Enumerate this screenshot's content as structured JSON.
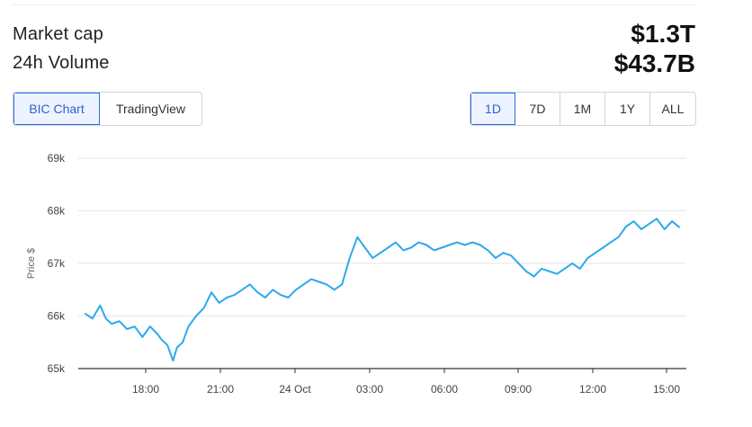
{
  "stats": [
    {
      "label": "Market cap",
      "value": "$1.3T"
    },
    {
      "label": "24h Volume",
      "value": "$43.7B"
    }
  ],
  "chart_source_tabs": {
    "options": [
      "BIC Chart",
      "TradingView"
    ],
    "active": "BIC Chart"
  },
  "range_tabs": {
    "options": [
      "1D",
      "7D",
      "1M",
      "1Y",
      "ALL"
    ],
    "active": "1D"
  },
  "colors": {
    "line": "#2ea8ec",
    "accent": "#2f6be0",
    "grid": "#e6e6e6"
  },
  "chart_data": {
    "type": "line",
    "ylabel": "Price $",
    "ylim": [
      65000,
      69000
    ],
    "y_ticks": [
      {
        "value": 65000,
        "label": "65k"
      },
      {
        "value": 66000,
        "label": "66k"
      },
      {
        "value": 67000,
        "label": "67k"
      },
      {
        "value": 68000,
        "label": "68k"
      },
      {
        "value": 69000,
        "label": "69k"
      }
    ],
    "x_unit": "hours since 00:00, 23 Oct",
    "xlim": [
      15.9,
      31.6
    ],
    "x_ticks": [
      {
        "value": 18,
        "label": "18:00"
      },
      {
        "value": 21,
        "label": "21:00"
      },
      {
        "value": 24,
        "label": "24 Oct"
      },
      {
        "value": 27,
        "label": "03:00"
      },
      {
        "value": 30,
        "label": "06:00"
      },
      {
        "value": 33,
        "label": "09:00"
      },
      {
        "value": 36,
        "label": "12:00"
      },
      {
        "value": 39,
        "label": "15:00"
      }
    ],
    "series": [
      {
        "x": [
          16.0,
          16.2,
          16.4,
          16.55,
          16.7,
          16.9,
          17.1,
          17.3,
          17.5,
          17.7,
          17.9,
          18.0,
          18.15,
          18.3,
          18.4,
          18.55,
          18.7,
          18.9,
          19.1,
          19.3,
          19.5,
          19.7,
          19.9,
          20.1,
          20.3,
          20.5,
          20.7,
          20.9,
          21.1,
          21.3,
          21.5,
          21.7,
          21.9,
          22.1,
          22.3,
          22.5,
          22.7,
          22.9,
          23.1,
          23.3,
          23.5,
          23.7,
          23.9,
          24.1,
          24.3,
          24.5,
          24.7,
          24.9,
          25.0,
          25.1,
          25.3,
          25.5,
          25.7,
          25.9,
          26.1,
          26.3,
          26.5,
          26.7,
          26.9,
          27.1,
          27.3,
          27.5,
          27.7,
          27.9,
          28.1,
          28.3,
          28.5,
          28.7,
          28.9,
          29.1,
          29.3,
          29.5,
          29.7,
          29.9,
          30.1,
          30.3,
          30.5,
          30.7,
          30.9,
          31.1,
          31.3,
          31.5
        ],
        "y": [
          66050,
          65950,
          66200,
          65950,
          65850,
          65900,
          65750,
          65800,
          65600,
          65800,
          65650,
          65550,
          65450,
          65150,
          65400,
          65500,
          65800,
          66000,
          66150,
          66450,
          66250,
          66350,
          66400,
          66500,
          66600,
          66450,
          66350,
          66500,
          66400,
          66350,
          66500,
          66600,
          66700,
          66650,
          66600,
          66500,
          66600,
          67100,
          67500,
          67300,
          67100,
          67200,
          67300,
          67400,
          67250,
          67300,
          67400,
          67350,
          67300,
          67250,
          67300,
          67350,
          67400,
          67350,
          67400,
          67350,
          67250,
          67100,
          67200,
          67150,
          67000,
          66850,
          66750,
          66900,
          66850,
          66800,
          66900,
          67000,
          66900,
          67100,
          67200,
          67300,
          67400,
          67500,
          67700,
          67800,
          67650,
          67750,
          67850,
          67650,
          67800,
          67680
        ]
      }
    ]
  }
}
